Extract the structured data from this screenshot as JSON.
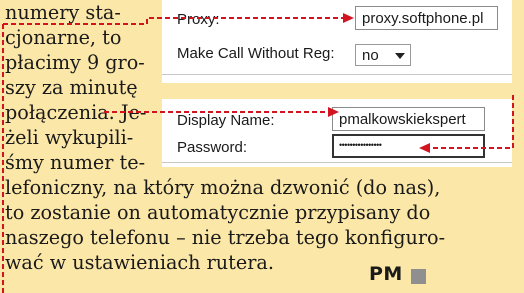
{
  "article": {
    "lines": [
      "numery sta-",
      "cjonarne, to",
      "płacimy 9 gro-",
      "szy za minutę",
      "połączenia. Je-",
      "żeli wykupili-",
      "śmy numer te-",
      "lefoniczny, na który można dzwonić (do nas),",
      "to zostanie on automatycznie przypisany do",
      "naszego telefonu – nie trzeba tego konfiguro-",
      "wać w ustawieniach rutera."
    ],
    "signature": "PM"
  },
  "settings_top": {
    "proxy_label": "Proxy:",
    "proxy_value": "proxy.softphone.pl",
    "make_call_label": "Make Call Without Reg:",
    "make_call_value": "no"
  },
  "settings_bottom": {
    "display_name_label": "Display Name:",
    "display_name_value": "pmalkowskiekspert",
    "password_label": "Password:",
    "password_value": "••••••••••••••••"
  },
  "colors": {
    "background": "#fbe7a7",
    "arrow": "#d3131f",
    "end_square": "#8f8f8f"
  }
}
